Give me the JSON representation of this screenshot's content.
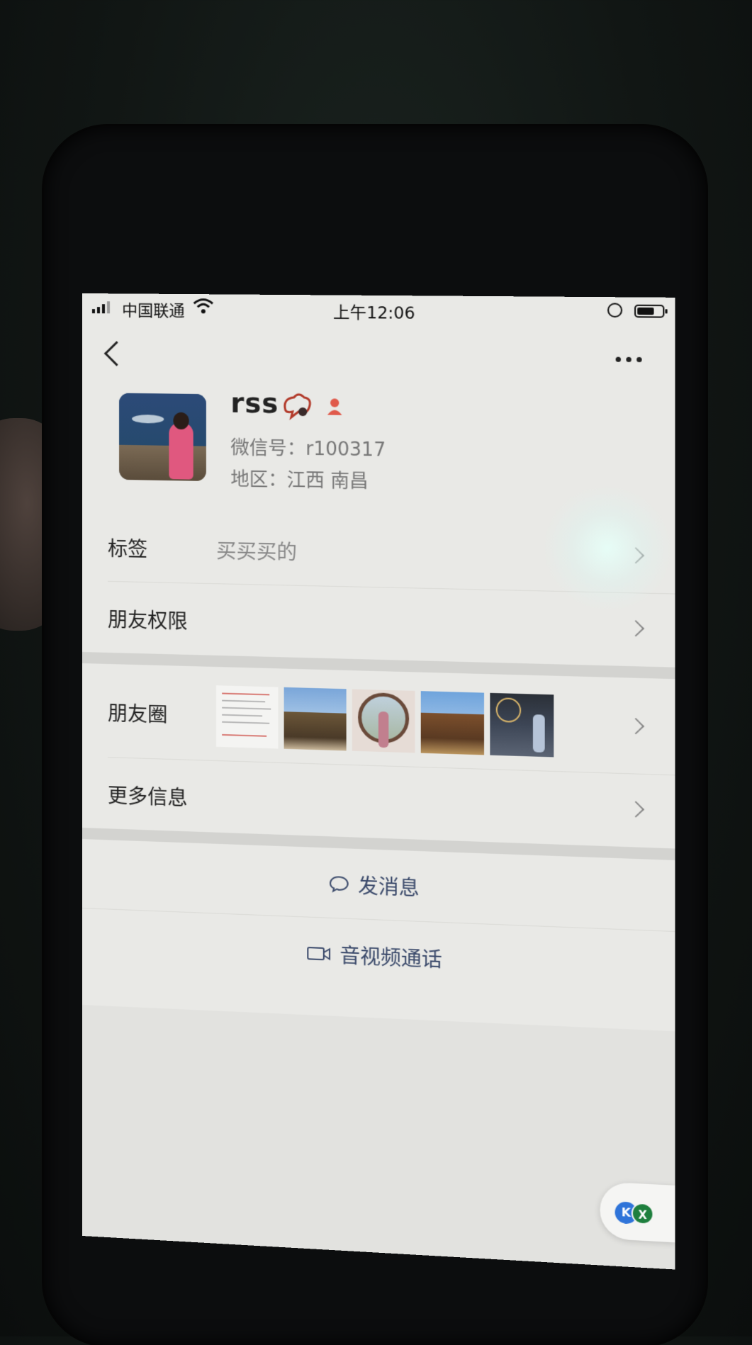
{
  "status_bar": {
    "carrier": "中国联通",
    "time": "上午12:06",
    "icons": [
      "signal-icon",
      "wifi-icon",
      "orientation-lock-icon",
      "battery-icon"
    ]
  },
  "header": {
    "back_icon": "chevron-left-icon",
    "more_icon": "more-dots-icon"
  },
  "profile": {
    "name": "rss",
    "wechat_id": "微信号：r100317",
    "region": "地区：江西 南昌",
    "gender_icon_color": "#e05a4b"
  },
  "rows": {
    "tags": {
      "label": "标签",
      "value": "买买买的"
    },
    "permissions": {
      "label": "朋友权限"
    },
    "moments": {
      "label": "朋友圈"
    },
    "more_info": {
      "label": "更多信息"
    }
  },
  "actions": {
    "message": "发消息",
    "video_call": "音视频通话"
  },
  "floating_widget": {
    "left_badge": "K",
    "right_badge": "X"
  },
  "colors": {
    "action_text": "#3b4a6b",
    "background": "#e9e9e6"
  }
}
